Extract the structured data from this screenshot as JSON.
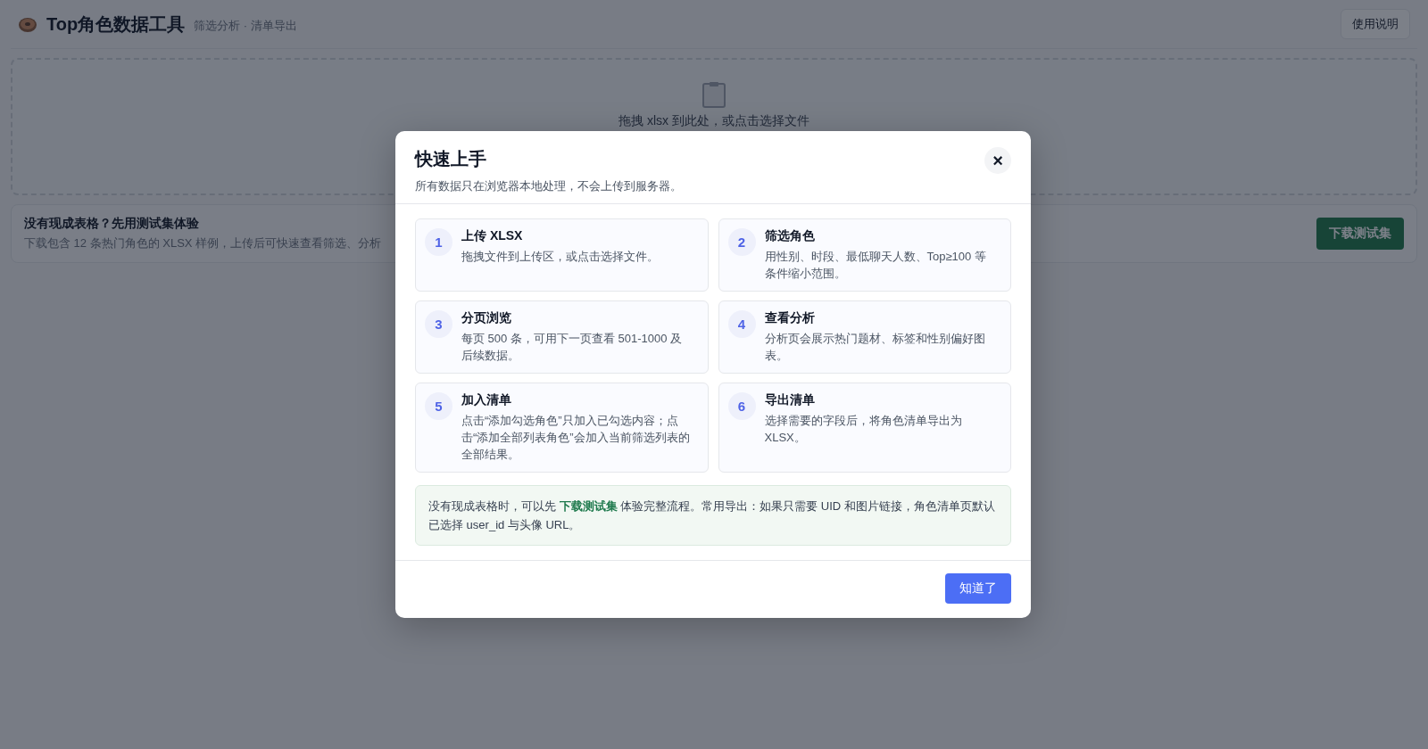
{
  "header": {
    "title": "Top角色数据工具",
    "subtitle": "筛选分析 · 清单导出",
    "help_button": "使用说明"
  },
  "upload": {
    "hint": "拖拽 xlsx 到此处，或点击选择文件"
  },
  "sample_banner": {
    "title": "没有现成表格？先用测试集体验",
    "text": "下载包含 12 条热门角色的 XLSX 样例，上传后可快速查看筛选、分析",
    "button": "下载测试集"
  },
  "dialog": {
    "title": "快速上手",
    "subtitle": "所有数据只在浏览器本地处理，不会上传到服务器。",
    "close": "×",
    "steps": [
      {
        "number": "1",
        "title": "上传 XLSX",
        "text": "拖拽文件到上传区，或点击选择文件。"
      },
      {
        "number": "2",
        "title": "筛选角色",
        "text": "用性别、时段、最低聊天人数、Top≥100 等条件缩小范围。"
      },
      {
        "number": "3",
        "title": "分页浏览",
        "text": "每页 500 条，可用下一页查看 501-1000 及后续数据。"
      },
      {
        "number": "4",
        "title": "查看分析",
        "text": "分析页会展示热门题材、标签和性别偏好图表。"
      },
      {
        "number": "5",
        "title": "加入清单",
        "text": "点击“添加勾选角色”只加入已勾选内容；点击“添加全部列表角色”会加入当前筛选列表的全部结果。"
      },
      {
        "number": "6",
        "title": "导出清单",
        "text": "选择需要的字段后，将角色清单导出为 XLSX。"
      }
    ],
    "tip": {
      "before": "没有现成表格时，可以先",
      "link": "下载测试集",
      "after": "体验完整流程。常用导出：如果只需要 UID 和图片链接，角色清单页默认已选择 user_id 与头像 URL。"
    },
    "ok_button": "知道了"
  }
}
